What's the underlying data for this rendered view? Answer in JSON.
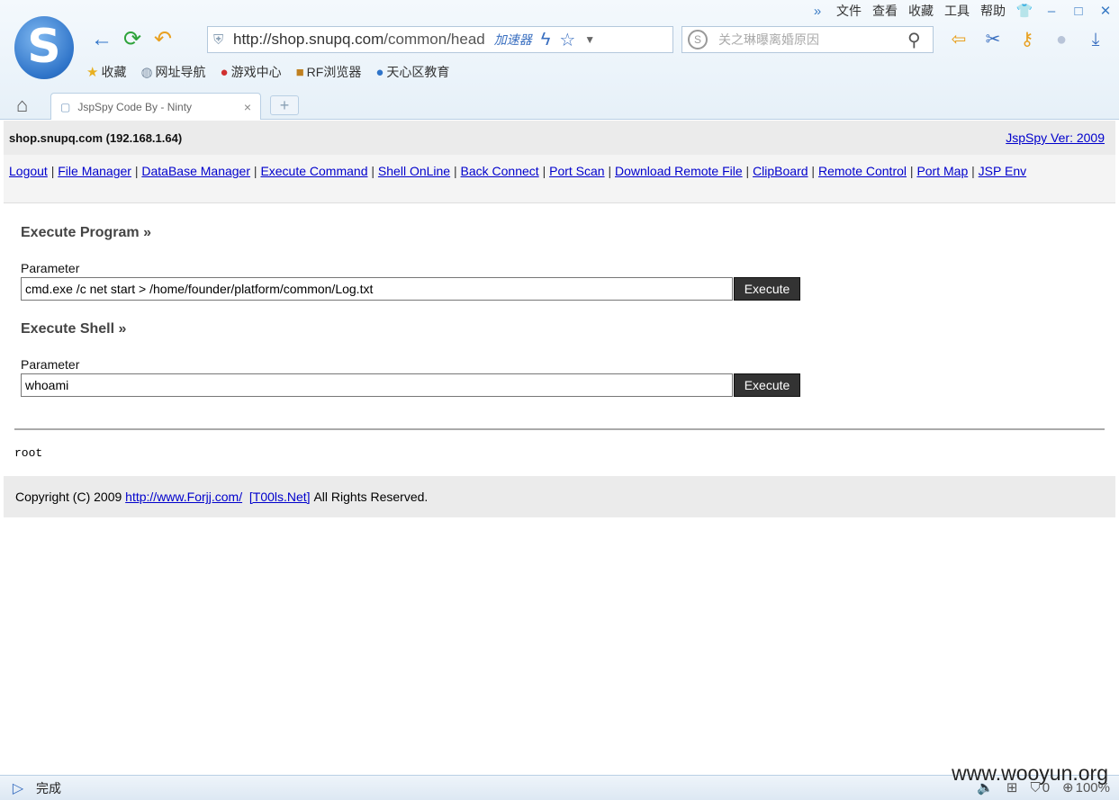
{
  "browser": {
    "menu": [
      "文件",
      "查看",
      "收藏",
      "工具",
      "帮助"
    ],
    "address": {
      "url_host": "http://shop.snupq.com",
      "url_path": "/common/head",
      "accelerator": "加速器"
    },
    "search": {
      "placeholder": "关之琳曝离婚原因"
    },
    "favorites": [
      "收藏",
      "网址导航",
      "游戏中心",
      "RF浏览器",
      "天心区教育"
    ],
    "tab": {
      "title": "JspSpy Code By - Ninty"
    },
    "status": {
      "text": "完成",
      "count": "0",
      "zoom": "100%"
    }
  },
  "page": {
    "host": "shop.snupq.com (192.168.1.64)",
    "version_link": "JspSpy Ver: 2009",
    "nav": [
      "Logout",
      "File Manager",
      "DataBase Manager",
      "Execute Command",
      "Shell OnLine",
      "Back Connect",
      "Port Scan",
      "Download Remote File",
      "ClipBoard",
      "Remote Control",
      "Port Map",
      "JSP Env"
    ],
    "execute_program": {
      "title": "Execute Program",
      "label": "Parameter",
      "value": "cmd.exe /c net start > /home/founder/platform/common/Log.txt",
      "button": "Execute"
    },
    "execute_shell": {
      "title": "Execute Shell",
      "label": "Parameter",
      "value": "whoami",
      "button": "Execute"
    },
    "output": "root",
    "footer": {
      "prefix": "Copyright (C) 2009",
      "link1": "http://www.Forjj.com/",
      "link2": "[T00ls.Net]",
      "suffix": "All Rights Reserved."
    }
  },
  "watermark": "www.wooyun.org"
}
